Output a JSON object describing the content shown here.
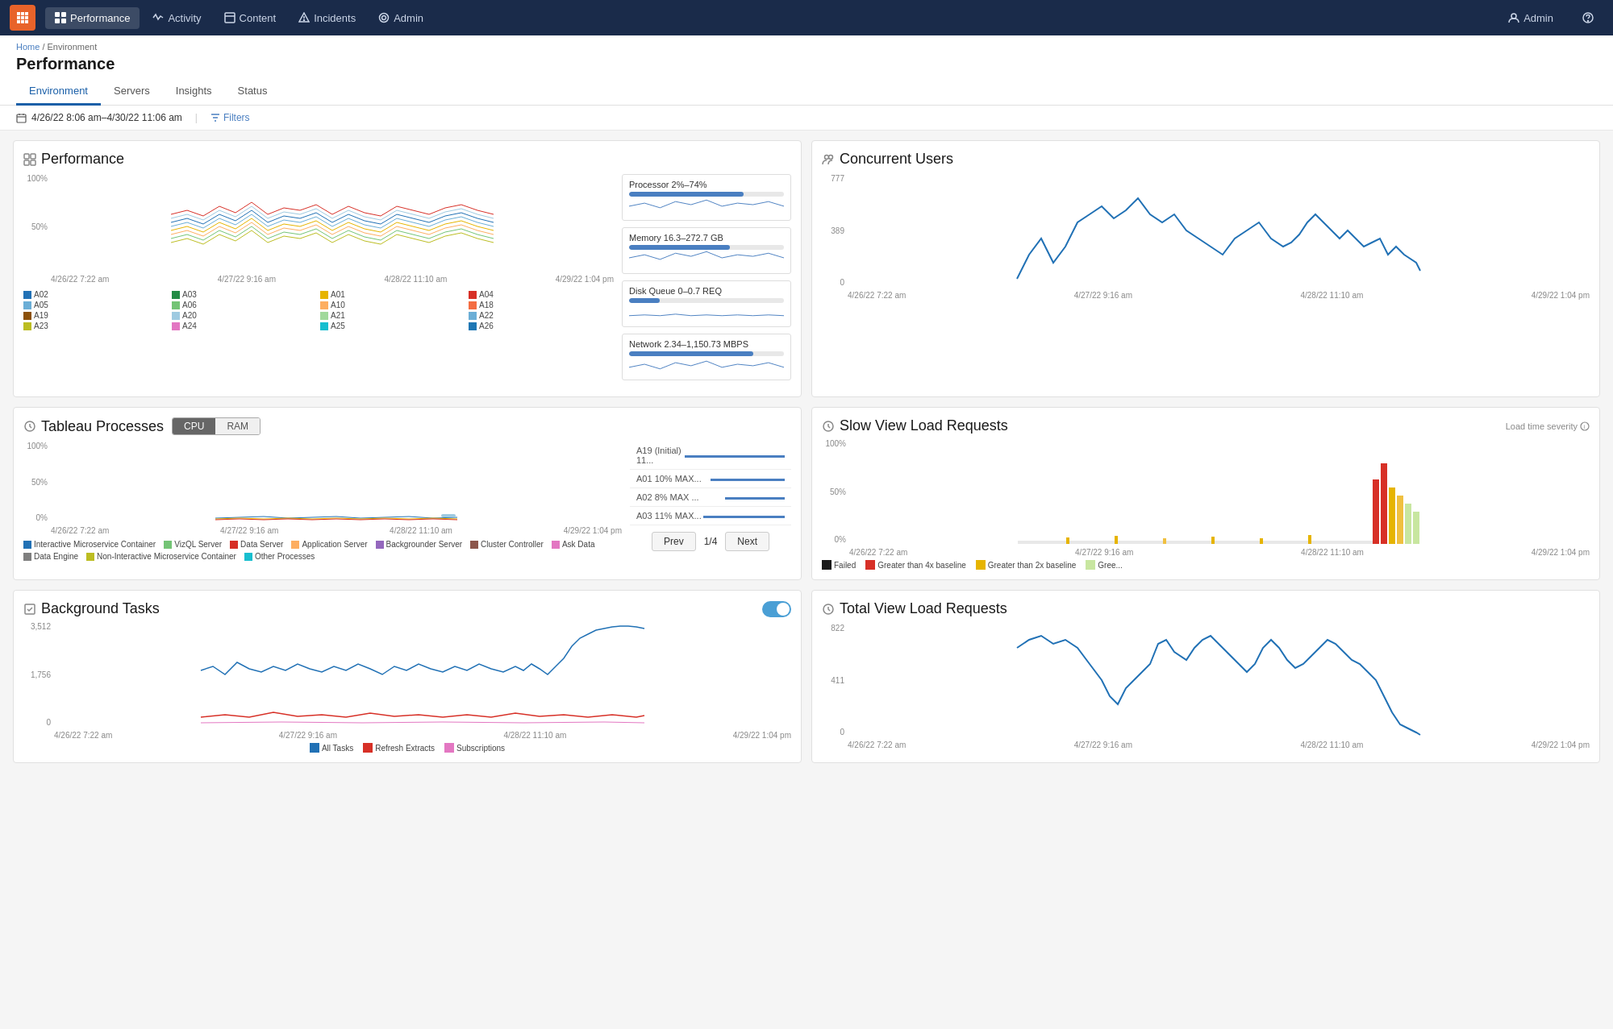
{
  "nav": {
    "logo_icon": "tableau-logo",
    "items": [
      {
        "label": "Performance",
        "icon": "grid-icon",
        "active": true
      },
      {
        "label": "Activity",
        "icon": "activity-icon",
        "active": false
      },
      {
        "label": "Content",
        "icon": "content-icon",
        "active": false
      },
      {
        "label": "Incidents",
        "icon": "incidents-icon",
        "active": false
      },
      {
        "label": "Admin",
        "icon": "admin-icon",
        "active": false
      }
    ],
    "right": [
      {
        "label": "Admin",
        "icon": "user-icon"
      },
      {
        "label": "Help",
        "icon": "help-icon"
      }
    ]
  },
  "breadcrumb": {
    "home": "Home",
    "section": "Environment"
  },
  "page": {
    "title": "Performance",
    "tabs": [
      {
        "label": "Environment",
        "active": true
      },
      {
        "label": "Servers",
        "active": false
      },
      {
        "label": "Insights",
        "active": false
      },
      {
        "label": "Status",
        "active": false
      }
    ]
  },
  "filter_bar": {
    "date_range": "4/26/22 8:06 am–4/30/22 11:06 am",
    "filters_label": "Filters"
  },
  "performance_card": {
    "title": "Performance",
    "y_labels": [
      "100%",
      "50%",
      ""
    ],
    "x_labels": [
      "4/26/22 7:22 am",
      "4/27/22 9:16 am",
      "4/28/22 11:10 am",
      "4/29/22 1:04 pm"
    ],
    "metrics": [
      {
        "label": "Processor 2%–74%",
        "fill_pct": 74,
        "color": "#4a7fc1"
      },
      {
        "label": "Memory 16.3–272.7 GB",
        "fill_pct": 65,
        "color": "#4a7fc1"
      },
      {
        "label": "Disk Queue 0–0.7 REQ",
        "fill_pct": 20,
        "color": "#4a7fc1"
      },
      {
        "label": "Network 2.34–1,150.73 MBPS",
        "fill_pct": 80,
        "color": "#4a7fc1"
      }
    ],
    "servers": [
      {
        "name": "A02",
        "color": "#2171b5"
      },
      {
        "name": "A03",
        "color": "#238b45"
      },
      {
        "name": "A01",
        "color": "#e6b400"
      },
      {
        "name": "A04",
        "color": "#d73027"
      },
      {
        "name": "A05",
        "color": "#6baed6"
      },
      {
        "name": "A06",
        "color": "#74c476"
      },
      {
        "name": "A10",
        "color": "#fdae61"
      },
      {
        "name": "A18",
        "color": "#f46d43"
      },
      {
        "name": "A19",
        "color": "#8c510a"
      },
      {
        "name": "A20",
        "color": "#9ecae1"
      },
      {
        "name": "A21",
        "color": "#a1d99b"
      },
      {
        "name": "A22",
        "color": "#6baed6"
      },
      {
        "name": "A23",
        "color": "#bcbd22"
      },
      {
        "name": "A24",
        "color": "#e377c2"
      },
      {
        "name": "A25",
        "color": "#17becf"
      },
      {
        "name": "A26",
        "color": "#1f77b4"
      }
    ]
  },
  "tableau_processes": {
    "title": "Tableau Processes",
    "toggle": {
      "cpu_label": "CPU",
      "ram_label": "RAM",
      "active": "CPU"
    },
    "x_labels": [
      "4/26/22 7:22 am",
      "4/27/22 9:16 am",
      "4/28/22 11:10 am",
      "4/29/22 1:04 pm"
    ],
    "y_labels": [
      "100%",
      "50%",
      "0%"
    ],
    "servers": [
      {
        "name": "A19 (Initial) 11...",
        "pct": 85
      },
      {
        "name": "A01 10% MAX...",
        "pct": 40
      },
      {
        "name": "A02 8% MAX ...",
        "pct": 30
      },
      {
        "name": "A03 11% MAX...",
        "pct": 45
      }
    ],
    "pagination": {
      "current": 1,
      "total": 4,
      "label": "1/4"
    },
    "legend": [
      {
        "label": "Interactive Microservice Container",
        "color": "#2171b5"
      },
      {
        "label": "VizQL Server",
        "color": "#74c476"
      },
      {
        "label": "Data Server",
        "color": "#d73027"
      },
      {
        "label": "Application Server",
        "color": "#fdae61"
      },
      {
        "label": "Backgrounder Server",
        "color": "#9467bd"
      },
      {
        "label": "Cluster Controller",
        "color": "#8c564b"
      },
      {
        "label": "Ask Data",
        "color": "#e377c2"
      },
      {
        "label": "Data Engine",
        "color": "#7f7f7f"
      },
      {
        "label": "Non-Interactive Microservice Container",
        "color": "#bcbd22"
      },
      {
        "label": "Other Processes",
        "color": "#17becf"
      }
    ],
    "prev_label": "Prev",
    "next_label": "Next"
  },
  "background_tasks": {
    "title": "Background Tasks",
    "toggle_on": true,
    "y_labels": [
      "3,512",
      "1,756",
      "0"
    ],
    "x_labels": [
      "4/26/22 7:22 am",
      "4/27/22 9:16 am",
      "4/28/22 11:10 am",
      "4/29/22 1:04 pm"
    ],
    "legend": [
      {
        "label": "All Tasks",
        "color": "#2171b5"
      },
      {
        "label": "Refresh Extracts",
        "color": "#d73027"
      },
      {
        "label": "Subscriptions",
        "color": "#e377c2"
      }
    ]
  },
  "concurrent_users": {
    "title": "Concurrent Users",
    "y_labels": [
      "777",
      "389",
      "0"
    ],
    "x_labels": [
      "4/26/22 7:22 am",
      "4/27/22 9:16 am",
      "4/28/22 11:10 am",
      "4/29/22 1:04 pm"
    ]
  },
  "slow_view_load": {
    "title": "Slow View Load Requests",
    "severity_label": "Load time severity",
    "y_labels": [
      "100%",
      "50%",
      "0%"
    ],
    "x_labels": [
      "4/26/22 7:22 am",
      "4/27/22 9:16 am",
      "4/28/22 11:10 am",
      "4/29/22 1:04 pm"
    ],
    "legend": [
      {
        "label": "Failed",
        "color": "#1a1a1a"
      },
      {
        "label": "Greater than 4x baseline",
        "color": "#d73027"
      },
      {
        "label": "Greater than 2x baseline",
        "color": "#e6b400"
      },
      {
        "label": "Gree...",
        "color": "#c8e6a0"
      }
    ]
  },
  "total_view_load": {
    "title": "Total View Load Requests",
    "y_labels": [
      "822",
      "411",
      "0"
    ],
    "x_labels": [
      "4/26/22 7:22 am",
      "4/27/22 9:16 am",
      "4/28/22 11:10 am",
      "4/29/22 1:04 pm"
    ]
  }
}
